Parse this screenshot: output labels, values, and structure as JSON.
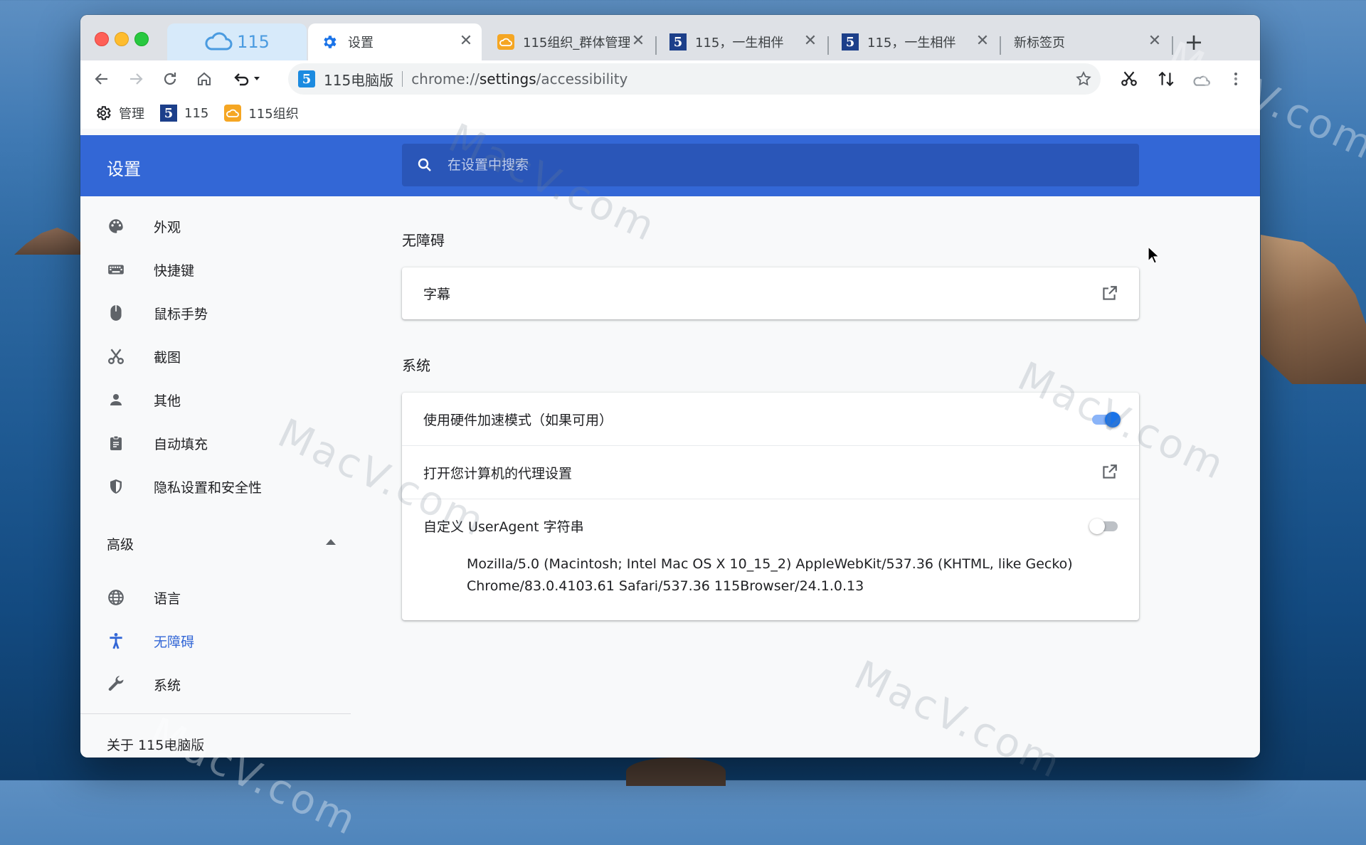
{
  "window": {
    "tabs": [
      {
        "label": "115",
        "favicon": "cloud-icon"
      },
      {
        "label": "设置",
        "favicon": "gear-icon"
      },
      {
        "label": "115组织_群体管理",
        "favicon": "orange-cloud-icon"
      },
      {
        "label": "115，一生相伴",
        "favicon": "115-logo-icon"
      },
      {
        "label": "115，一生相伴",
        "favicon": "115-logo-icon"
      },
      {
        "label": "新标签页",
        "favicon": ""
      }
    ],
    "tab_close_glyph": "✕",
    "new_tab_glyph": "+"
  },
  "toolbar": {
    "site_name": "115电脑版",
    "url_scheme": "chrome://",
    "url_host": "settings",
    "url_path": "/accessibility"
  },
  "bookmarks": [
    {
      "label": "管理",
      "icon": "gear-outline-icon"
    },
    {
      "label": "115",
      "icon": "115-logo-icon"
    },
    {
      "label": "115组织",
      "icon": "orange-cloud-icon"
    }
  ],
  "settings": {
    "title": "设置",
    "search_placeholder": "在设置中搜索"
  },
  "sidebar": {
    "items": [
      {
        "label": "外观",
        "icon": "palette-icon"
      },
      {
        "label": "快捷键",
        "icon": "keyboard-icon"
      },
      {
        "label": "鼠标手势",
        "icon": "mouse-icon"
      },
      {
        "label": "截图",
        "icon": "scissors-icon"
      },
      {
        "label": "其他",
        "icon": "person-icon"
      },
      {
        "label": "自动填充",
        "icon": "clipboard-icon"
      },
      {
        "label": "隐私设置和安全性",
        "icon": "shield-icon"
      }
    ],
    "advanced_label": "高级",
    "advanced_items": [
      {
        "label": "语言",
        "icon": "globe-icon"
      },
      {
        "label": "无障碍",
        "icon": "accessibility-icon",
        "selected": true
      },
      {
        "label": "系统",
        "icon": "wrench-icon"
      }
    ],
    "about_label": "关于 115电脑版"
  },
  "main": {
    "accessibility_title": "无障碍",
    "captions_label": "字幕",
    "system_title": "系统",
    "hardware_accel_label": "使用硬件加速模式（如果可用）",
    "hardware_accel_enabled": true,
    "proxy_label": "打开您计算机的代理设置",
    "useragent_label": "自定义 UserAgent 字符串",
    "useragent_enabled": false,
    "useragent_line1": "Mozilla/5.0 (Macintosh; Intel Mac OS X 10_15_2) AppleWebKit/537.36 (KHTML, like Gecko)",
    "useragent_line2": "Chrome/83.0.4103.61 Safari/537.36 115Browser/24.1.0.13"
  },
  "watermark_text": "MacV.com",
  "colors": {
    "header_blue": "#3367d6",
    "selected_blue": "#3367d6",
    "toggle_on": "#1a73e8"
  }
}
